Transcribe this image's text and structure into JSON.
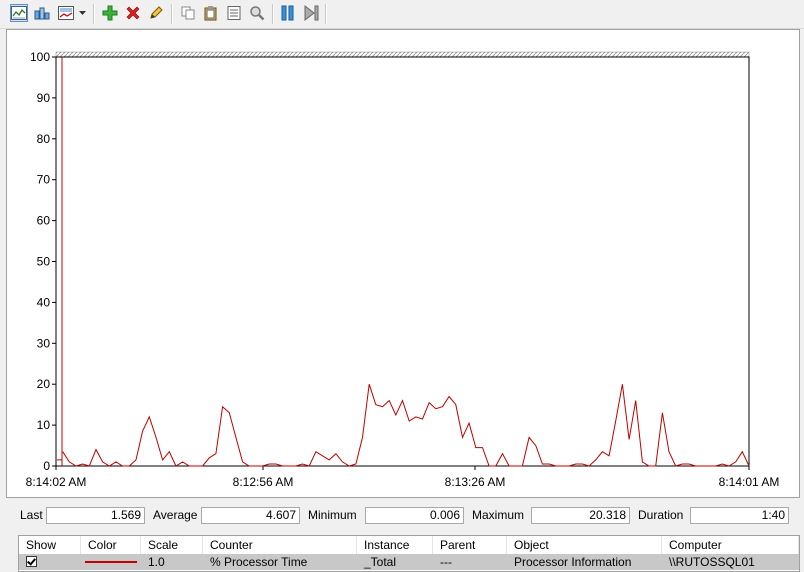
{
  "toolbar": {
    "buttons": [
      {
        "name": "view-graph-icon"
      },
      {
        "name": "view-histogram-icon"
      },
      {
        "name": "change-graph-type-icon"
      },
      {
        "name": "dropdown-arrow-icon"
      },
      {
        "name": "add-counter-icon"
      },
      {
        "name": "delete-counter-icon"
      },
      {
        "name": "highlight-icon"
      },
      {
        "name": "copy-properties-icon"
      },
      {
        "name": "paste-counter-list-icon"
      },
      {
        "name": "properties-icon"
      },
      {
        "name": "zoom-icon"
      },
      {
        "name": "freeze-display-icon"
      },
      {
        "name": "update-data-icon"
      }
    ]
  },
  "chart_data": {
    "type": "line",
    "y_ticks": [
      "0",
      "10",
      "20",
      "30",
      "40",
      "50",
      "60",
      "70",
      "80",
      "90",
      "100"
    ],
    "ylim": [
      0,
      100
    ],
    "x_ticks": [
      "8:14:02 AM",
      "8:12:56 AM",
      "8:13:26 AM",
      "8:14:01 AM"
    ],
    "grid": false,
    "series": [
      {
        "name": "% Processor Time",
        "color": "#c00000",
        "values": [
          100,
          3.5,
          1,
          0,
          0.5,
          0,
          4,
          1,
          0,
          1,
          0,
          0,
          1.5,
          8.5,
          12,
          7,
          1.5,
          3.5,
          0,
          1,
          0,
          0,
          0,
          2,
          3,
          14.5,
          13,
          7,
          1,
          0,
          0,
          0,
          0.5,
          0.5,
          0,
          0,
          0,
          0.5,
          0,
          3.5,
          2.5,
          1.5,
          3,
          1,
          0,
          0.5,
          7,
          20,
          15,
          14.5,
          16,
          12.5,
          16,
          11,
          12,
          11.5,
          15.5,
          14,
          14.5,
          17,
          15,
          7,
          10.5,
          4.5,
          4.5,
          0,
          0,
          3,
          0,
          0,
          0,
          7,
          5,
          0.5,
          0.5,
          0,
          0,
          0,
          0.5,
          0.5,
          0,
          1.5,
          3.5,
          2.5,
          11,
          20,
          6.5,
          16,
          1,
          0,
          0,
          13,
          3.5,
          0,
          0.5,
          0.5,
          0,
          0,
          0,
          0,
          0.5,
          0,
          1,
          3.5,
          0
        ]
      }
    ]
  },
  "stats": {
    "last_label": "Last",
    "last": "1.569",
    "average_label": "Average",
    "average": "4.607",
    "minimum_label": "Minimum",
    "minimum": "0.006",
    "maximum_label": "Maximum",
    "maximum": "20.318",
    "duration_label": "Duration",
    "duration": "1:40"
  },
  "legend": {
    "headers": [
      "Show",
      "Color",
      "Scale",
      "Counter",
      "Instance",
      "Parent",
      "Object",
      "Computer"
    ],
    "row": {
      "show": true,
      "color": "#c00000",
      "scale": "1.0",
      "counter": "% Processor Time",
      "instance": "_Total",
      "parent": "---",
      "object": "Processor Information",
      "computer": "\\\\RUTOSSQL01"
    }
  }
}
